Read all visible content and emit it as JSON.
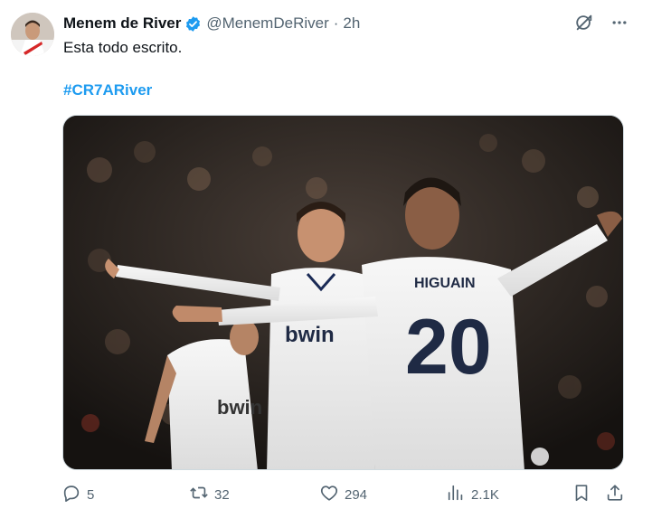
{
  "tweet": {
    "author_name": "Menem de River",
    "handle": "@MenemDeRiver",
    "separator": "·",
    "time": "2h",
    "text": "Esta todo escrito.",
    "hashtag": "#CR7ARiver"
  },
  "media": {
    "player_front_text": "HIGUAIN",
    "player_front_number": "20",
    "sponsor_text": "bwin"
  },
  "actions": {
    "replies": "5",
    "reposts": "32",
    "likes": "294",
    "views": "2.1K"
  },
  "icons": {
    "verified": "verified-badge-icon",
    "grok": "grok-icon",
    "more": "more-icon",
    "reply": "reply-icon",
    "repost": "repost-icon",
    "like": "heart-icon",
    "views": "views-icon",
    "bookmark": "bookmark-icon",
    "share": "share-icon"
  },
  "colors": {
    "accent": "#1d9bf0",
    "secondary_text": "#536471",
    "primary_text": "#0f1419"
  }
}
